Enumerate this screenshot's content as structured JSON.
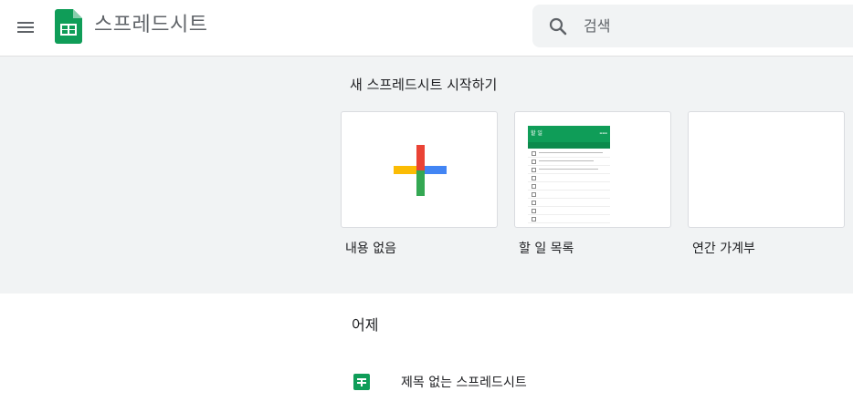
{
  "header": {
    "app_title": "스프레드시트",
    "search_placeholder": "검색",
    "brand_color": "#0f9d58"
  },
  "gallery": {
    "title": "새 스프레드시트 시작하기",
    "templates": [
      {
        "label": "내용 없음",
        "icon": "plus-icon"
      },
      {
        "label": "할 일 목록",
        "preview_title": "할 일"
      },
      {
        "label": "연간 가계부"
      }
    ]
  },
  "recent": {
    "section_title": "어제",
    "files": [
      {
        "name": "제목 없는 스프레드시트",
        "icon": "sheets-file-icon"
      }
    ]
  }
}
